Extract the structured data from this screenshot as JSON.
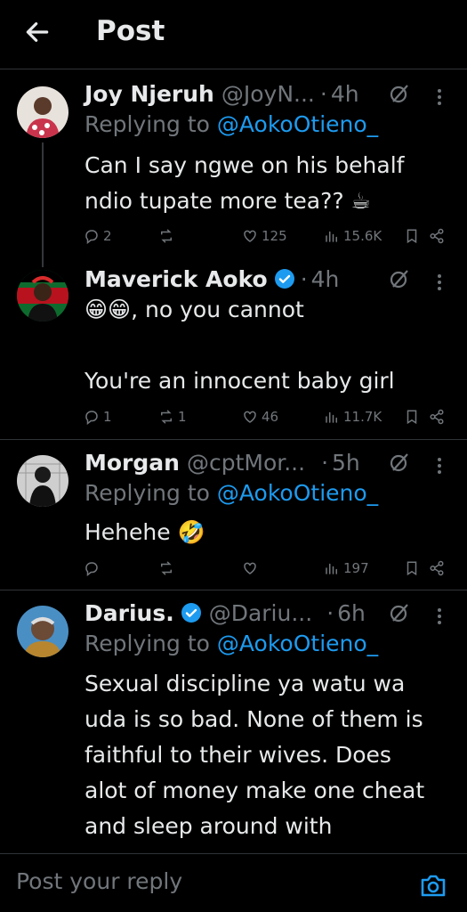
{
  "header": {
    "title": "Post"
  },
  "posts": [
    {
      "name": "Joy Njeruh",
      "handle": "@JoyN...",
      "dot": "·",
      "time": "4h",
      "verified": false,
      "replying_label": "Replying to ",
      "replying_to": "@AokoOtieno_",
      "text": "Can I say ngwe on his behalf\nndio tupate more tea?? ☕",
      "replies": "2",
      "reposts": "",
      "likes": "125",
      "views": "15.6K"
    },
    {
      "name": "Maverick Aoko",
      "handle": "",
      "dot": "·",
      "time": "4h",
      "verified": true,
      "text": "😁😁, no you cannot\n\nYou're an innocent baby girl",
      "replies": "1",
      "reposts": "1",
      "likes": "46",
      "views": "11.7K"
    },
    {
      "name": "Morgan",
      "handle": "@cptMor...",
      "dot": "·",
      "time": "5h",
      "verified": false,
      "replying_label": "Replying to ",
      "replying_to": "@AokoOtieno_",
      "text": "Hehehe 🤣",
      "replies": "",
      "reposts": "",
      "likes": "",
      "views": "197"
    },
    {
      "name": "Darius.",
      "handle": "@Dariu...",
      "dot": "·",
      "time": "6h",
      "verified": true,
      "replying_label": "Replying to ",
      "replying_to": "@AokoOtieno_",
      "text": "Sexual discipline ya watu wa\nuda is so bad. None of them is\nfaithful to their wives. Does\nalot of money make one cheat\nand sleep around with"
    }
  ],
  "compose": {
    "placeholder": "Post your reply"
  },
  "colors": {
    "accent": "#1d9bf0",
    "muted": "#71767b",
    "text": "#e7e9ea",
    "border": "#2f3336"
  }
}
